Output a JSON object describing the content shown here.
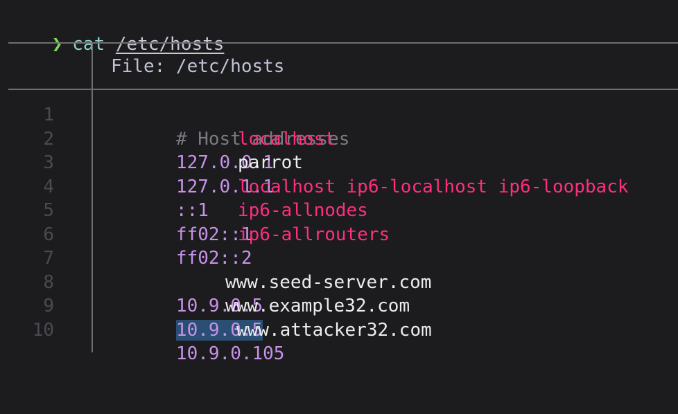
{
  "prompt": {
    "symbol": "❯",
    "command": "cat",
    "argument": "/etc/hosts"
  },
  "file_header": "File: /etc/hosts",
  "lines": [
    {
      "num": "1",
      "comment": "# Host addresses",
      "addr": "",
      "host": ""
    },
    {
      "num": "2",
      "comment": "",
      "addr": "127.0.0.1",
      "host": "localhost"
    },
    {
      "num": "3",
      "comment": "",
      "addr": "127.0.1.1",
      "host": "parrot"
    },
    {
      "num": "4",
      "comment": "",
      "addr": "::1",
      "host": "localhost ip6-localhost ip6-loopback"
    },
    {
      "num": "5",
      "comment": "",
      "addr": "ff02::1",
      "host": "ip6-allnodes"
    },
    {
      "num": "6",
      "comment": "",
      "addr": "ff02::2",
      "host": "ip6-allrouters"
    },
    {
      "num": "7",
      "comment": "",
      "addr": "",
      "host": ""
    },
    {
      "num": "8",
      "comment": "",
      "addr": "10.9.0.5",
      "host": "www.seed-server.com"
    },
    {
      "num": "9",
      "comment": "",
      "addr": "10.9.0.5",
      "host": "www.example32.com"
    },
    {
      "num": "10",
      "comment": "",
      "addr": "10.9.0.105",
      "host": "www.attacker32.com"
    }
  ],
  "colors": {
    "background": "#1c1c1e",
    "prompt_symbol": "#7ed957",
    "ip_address": "#c792ea",
    "hostname_highlight": "#ff2e7e",
    "hostname_plain": "#ececec",
    "comment": "#7a7a82",
    "selection": "#2b4f74"
  }
}
